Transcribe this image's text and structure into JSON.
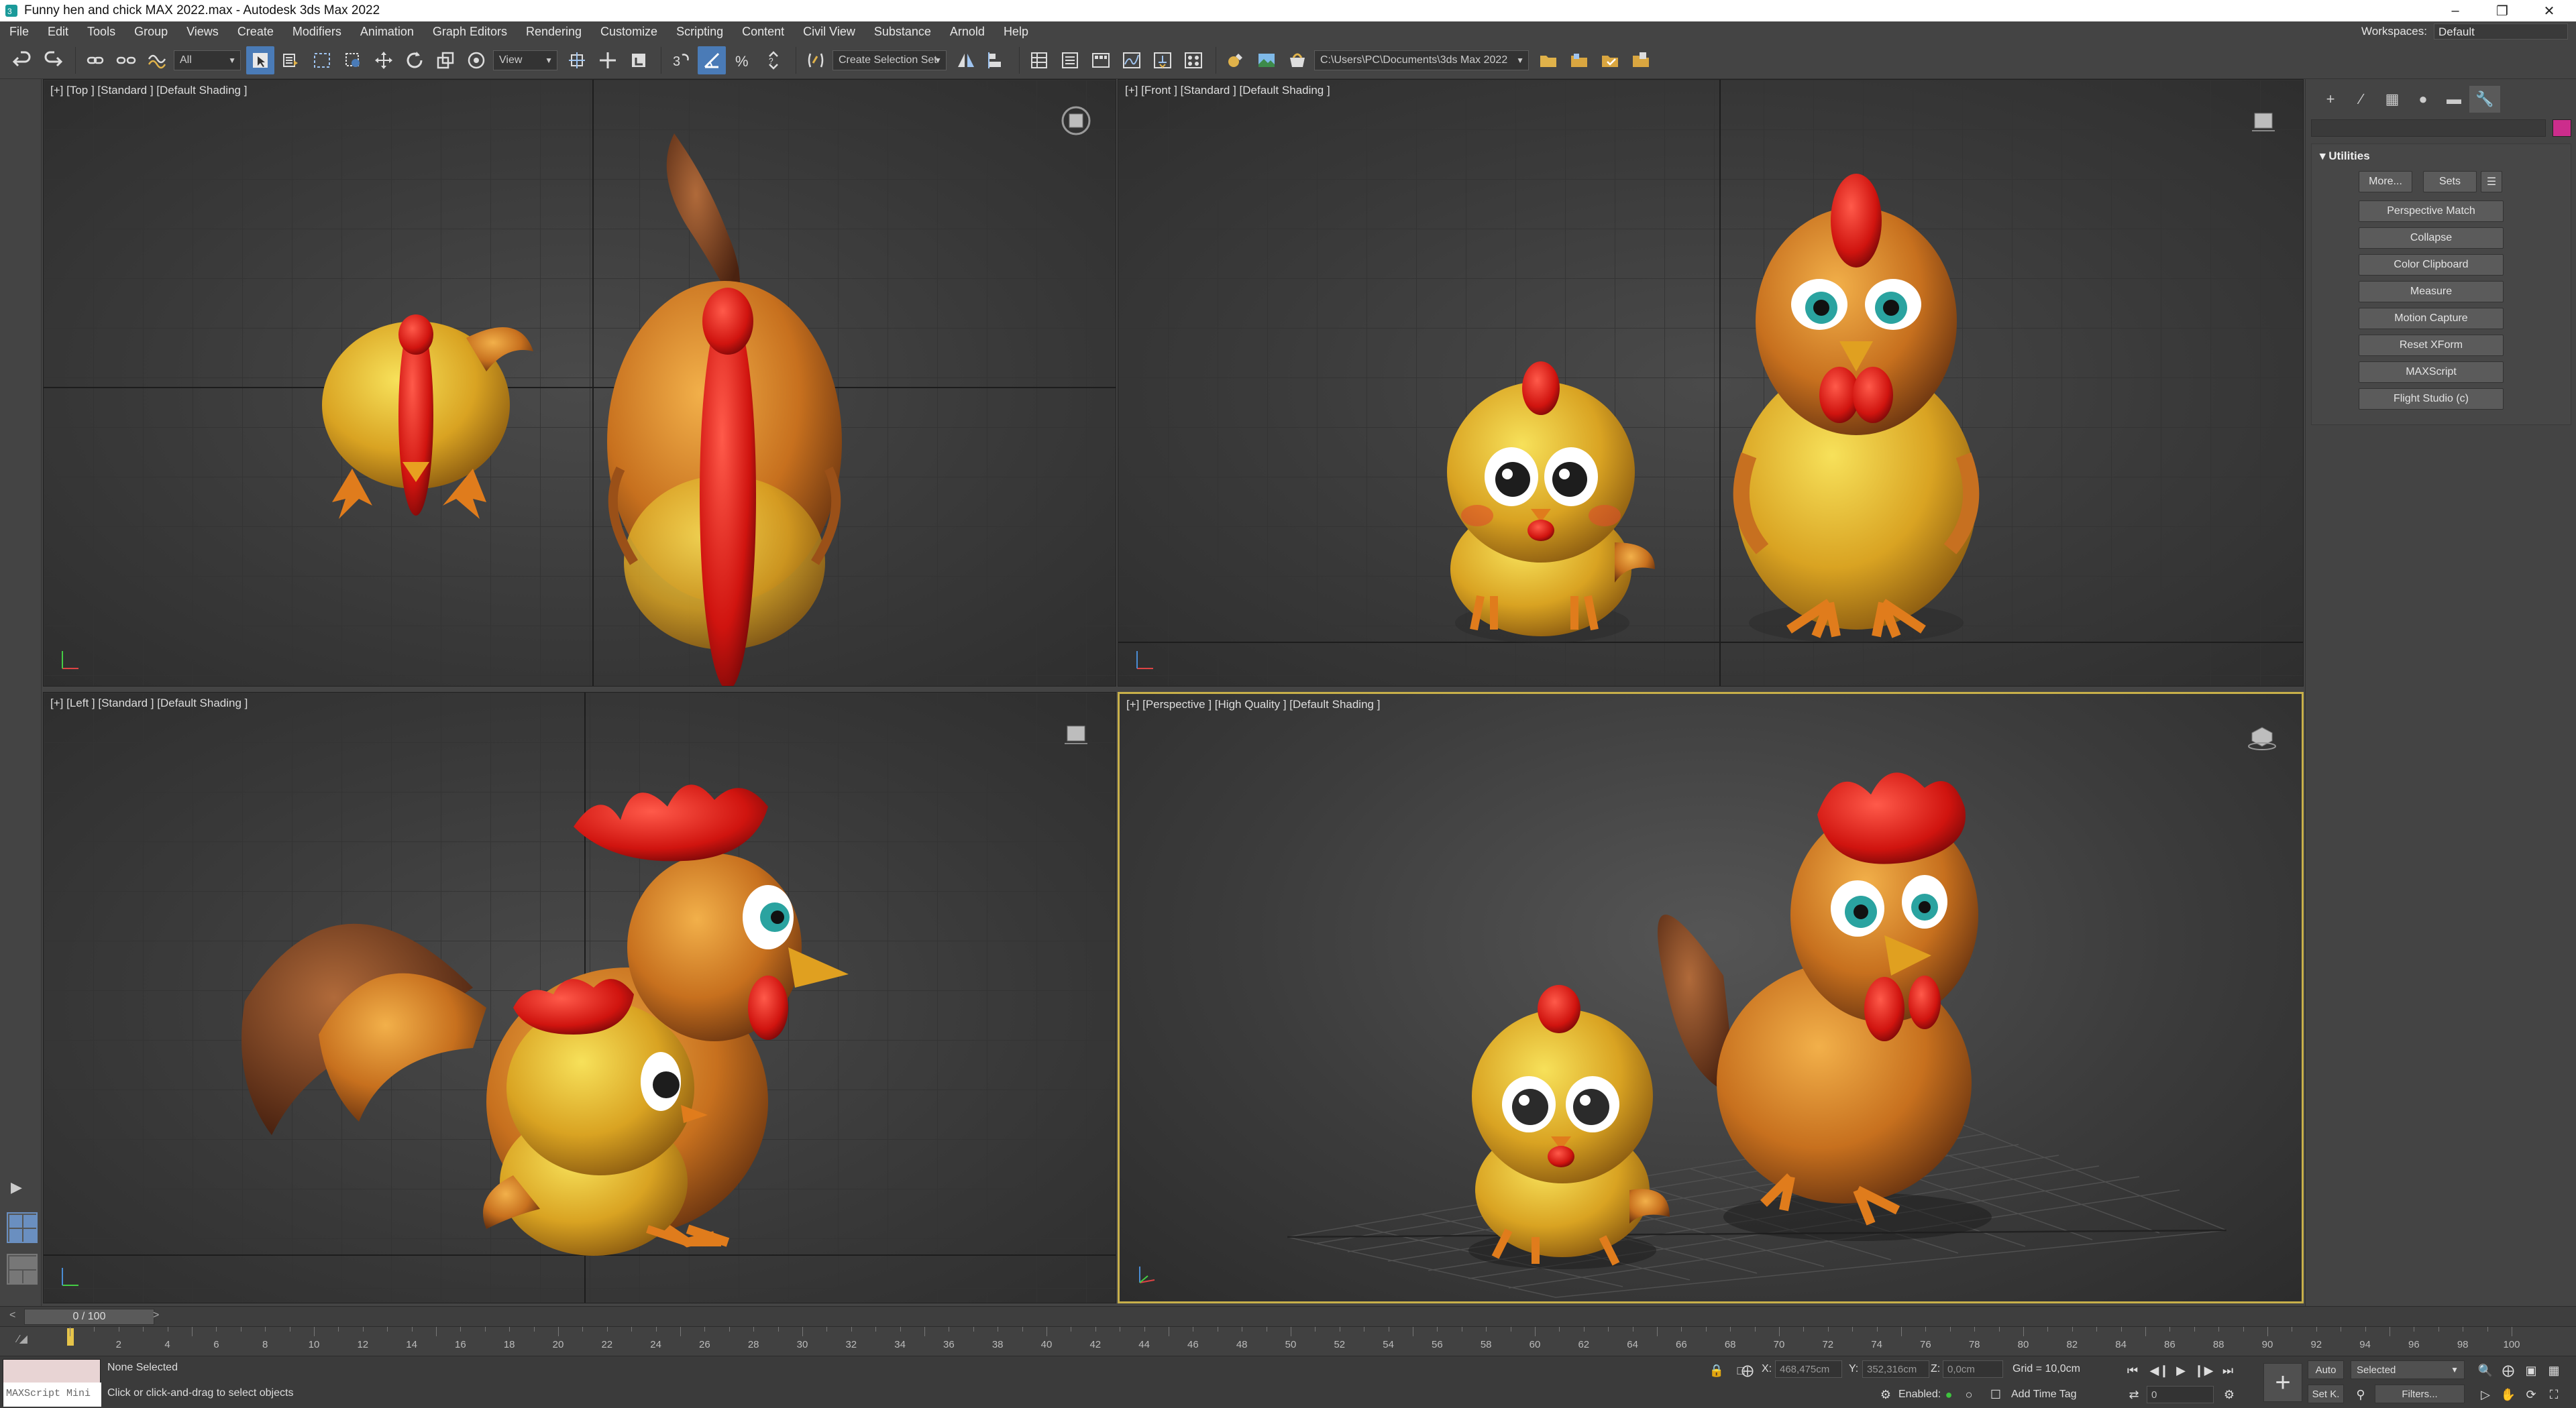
{
  "window": {
    "title": "Funny hen and chick MAX 2022.max - Autodesk 3ds Max 2022"
  },
  "menu": {
    "items": [
      "File",
      "Edit",
      "Tools",
      "Group",
      "Views",
      "Create",
      "Modifiers",
      "Animation",
      "Graph Editors",
      "Rendering",
      "Customize",
      "Scripting",
      "Content",
      "Civil View",
      "Substance",
      "Arnold",
      "Help"
    ],
    "workspaces_label": "Workspaces:",
    "workspaces_value": "Default"
  },
  "toolbar": {
    "selection_filter": "All",
    "ref_coord": "View",
    "named_selection": "Create Selection Set",
    "project_path": "C:\\Users\\PC\\Documents\\3ds Max 2022"
  },
  "viewports": {
    "top": {
      "label": "[+] [Top ] [Standard ] [Default Shading ]"
    },
    "front": {
      "label": "[+] [Front ] [Standard ] [Default Shading ]"
    },
    "left": {
      "label": "[+] [Left ] [Standard ] [Default Shading ]"
    },
    "perspective": {
      "label": "[+] [Perspective ] [High Quality ] [Default Shading ]"
    }
  },
  "command_panel": {
    "rollout_title": "Utilities",
    "more_button": "More...",
    "sets_button": "Sets",
    "utilities": [
      "Perspective Match",
      "Collapse",
      "Color Clipboard",
      "Measure",
      "Motion Capture",
      "Reset XForm",
      "MAXScript",
      "Flight Studio (c)"
    ],
    "active_color": "#cc2d8c"
  },
  "timeline": {
    "slider_text": "0 / 100",
    "ticks": [
      2,
      4,
      6,
      8,
      10,
      12,
      14,
      16,
      18,
      20,
      22,
      24,
      26,
      28,
      30,
      32,
      34,
      36,
      38,
      40,
      42,
      44,
      46,
      48,
      50,
      52,
      54,
      56,
      58,
      60,
      62,
      64,
      66,
      68,
      70,
      72,
      74,
      76,
      78,
      80,
      82,
      84,
      86,
      88,
      90,
      92,
      94,
      96,
      98,
      100
    ]
  },
  "status": {
    "maxscript_placeholder": "MAXScript Mini",
    "selection": "None Selected",
    "prompt": "Click or click-and-drag to select objects",
    "x_label": "X:",
    "x_value": "468,475cm",
    "y_label": "Y:",
    "y_value": "352,316cm",
    "z_label": "Z:",
    "z_value": "0,0cm",
    "grid": "Grid = 10,0cm",
    "enabled_label": "Enabled:",
    "add_time_tag": "Add Time Tag",
    "auto_key": "Auto",
    "set_key": "Set K.",
    "key_mode": "Selected",
    "frame_value": "0",
    "filters": "Filters..."
  }
}
